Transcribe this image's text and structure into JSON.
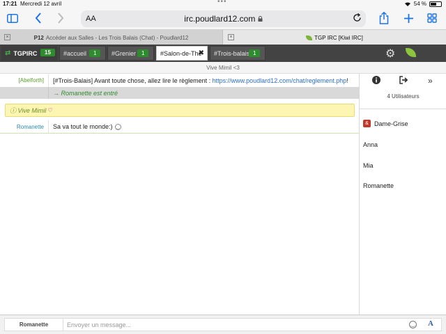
{
  "status": {
    "time": "17:21",
    "date": "Mercredi 12 avril",
    "battery": "54 %"
  },
  "safari": {
    "aa": "AA",
    "url": "irc.poudlard12.com"
  },
  "browser_tabs": [
    {
      "favicon": "P12",
      "title": "Accéder aux Salles - Les Trois Balais (Chat) - Poudlard12"
    },
    {
      "title": "TGP IRC [Kiwi IRC]"
    }
  ],
  "kiwi": {
    "network": {
      "label": "TGPIRC",
      "count": "15"
    },
    "channels": [
      {
        "label": "#accueil",
        "count": "1"
      },
      {
        "label": "#Grenier",
        "count": "1"
      },
      {
        "label": "#Salon-de-The",
        "count": ""
      },
      {
        "label": "#Trois-balais",
        "count": "1"
      }
    ],
    "topic": "Vive Mimil <3"
  },
  "messages": [
    {
      "nick": "[Abelforth]",
      "text": "[#Trois-Balais] Avant toute chose, allez lire le règlement : ",
      "link": "https://www.poudlard12.com/chat/reglement.php",
      "suffix": " !"
    },
    {
      "nick": "",
      "text": "→ Romanette est entré"
    },
    {
      "nick": "",
      "text": "ⓘ Vive Mimil"
    },
    {
      "nick": "Romanette",
      "text": "Sa va tout le monde:)"
    }
  ],
  "userlist": {
    "count": "4 Utilisateurs",
    "users": [
      {
        "name": "Dame-Grise",
        "prefix": "&"
      },
      {
        "name": "Anna",
        "prefix": ""
      },
      {
        "name": "Mia",
        "prefix": ""
      },
      {
        "name": "Romanette",
        "prefix": ""
      }
    ]
  },
  "input": {
    "nick": "Romanette",
    "placeholder": "Envoyer un message..."
  },
  "icons": {
    "sidebar": "sidebar-icon",
    "back": "chevron-left-icon",
    "forward": "chevron-right-icon",
    "lock": "lock-icon",
    "reload": "reload-icon",
    "share": "share-icon",
    "new_tab": "plus-icon",
    "tabs": "tabs-grid-icon",
    "settings": "gears-icon",
    "info": "info-icon",
    "leave": "leave-icon",
    "collapse": "double-chevron-right-icon",
    "emoji": "emoji-icon",
    "format": "format-text-icon"
  },
  "colors": {
    "accent": "#1a73e8",
    "kiwi_bar": "#434343",
    "badge": "#2e8b2e",
    "join": "#2e8b2e",
    "highlight": "#fdf6b3",
    "op": "#c0392b"
  }
}
